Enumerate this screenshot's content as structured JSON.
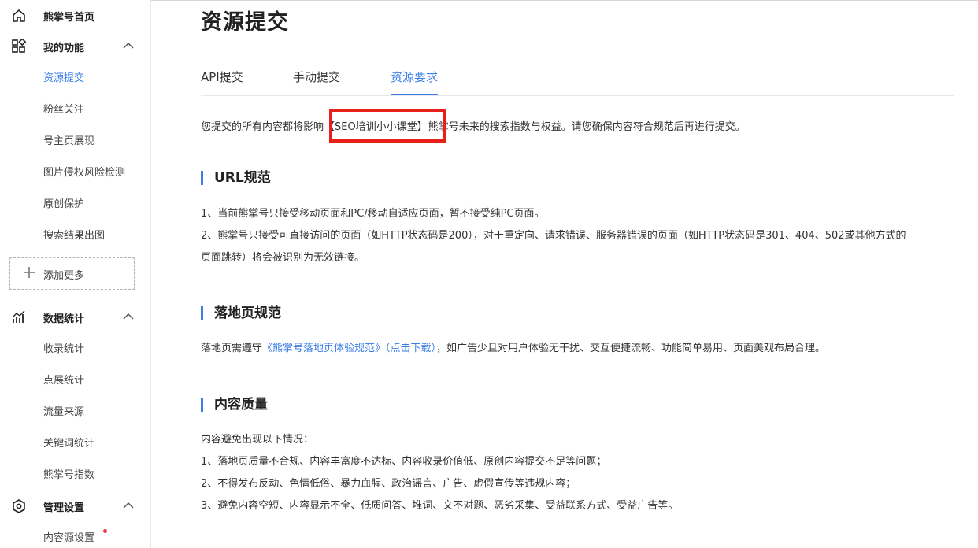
{
  "sidebar": {
    "home": {
      "label": "熊掌号首页",
      "icon": "home-icon"
    },
    "functions": {
      "label": "我的功能",
      "icon": "grid-icon",
      "items": [
        {
          "label": "资源提交",
          "active": true
        },
        {
          "label": "粉丝关注"
        },
        {
          "label": "号主页展现"
        },
        {
          "label": "图片侵权风险检测"
        },
        {
          "label": "原创保护"
        },
        {
          "label": "搜索结果出图"
        }
      ]
    },
    "add_more": {
      "label": "添加更多",
      "icon": "plus-icon"
    },
    "stats": {
      "label": "数据统计",
      "icon": "bar-chart-icon",
      "items": [
        {
          "label": "收录统计"
        },
        {
          "label": "点展统计"
        },
        {
          "label": "流量来源"
        },
        {
          "label": "关键词统计"
        },
        {
          "label": "熊掌号指数"
        }
      ]
    },
    "settings": {
      "label": "管理设置",
      "icon": "settings-icon",
      "items": [
        {
          "label": "内容源设置",
          "has_dot": true
        }
      ]
    }
  },
  "main": {
    "title": "资源提交",
    "tabs": [
      {
        "label": "API提交"
      },
      {
        "label": "手动提交"
      },
      {
        "label": "资源要求",
        "active": true
      }
    ],
    "notice": {
      "before": "您提交的所有内容都将影响",
      "highlight": "【SEO培训小小课堂】",
      "after": "熊掌号未来的搜索指数与权益。请您确保内容符合规范后再进行提交。"
    },
    "sections": {
      "url": {
        "title": "URL规范",
        "lines": [
          "1、当前熊掌号只接受移动页面和PC/移动自适应页面，暂不接受纯PC页面。",
          "2、熊掌号只接受可直接访问的页面（如HTTP状态码是200），对于重定向、请求错误、服务器错误的页面（如HTTP状态码是301、404、502或其他方式的",
          "页面跳转）将会被识别为无效链接。"
        ]
      },
      "landing": {
        "title": "落地页规范",
        "text_before": "落地页需遵守",
        "link_text": "《熊掌号落地页体验规范》（点击下载）",
        "text_after": "，如广告少且对用户体验无干扰、交互便捷流畅、功能简单易用、页面美观布局合理。"
      },
      "quality": {
        "title": "内容质量",
        "lines": [
          "内容避免出现以下情况：",
          "1、落地页质量不合规、内容丰富度不达标、内容收录价值低、原创内容提交不足等问题；",
          "2、不得发布反动、色情低俗、暴力血腥、政治谣言、广告、虚假宣传等违规内容；",
          "3、避免内容空短、内容显示不全、低质问答、堆词、文不对题、恶劣采集、受益联系方式、受益广告等。"
        ]
      }
    }
  },
  "colors": {
    "accent": "#3a7ee8",
    "highlight_box": "#e8201a",
    "badge_dot": "#f5333f"
  }
}
